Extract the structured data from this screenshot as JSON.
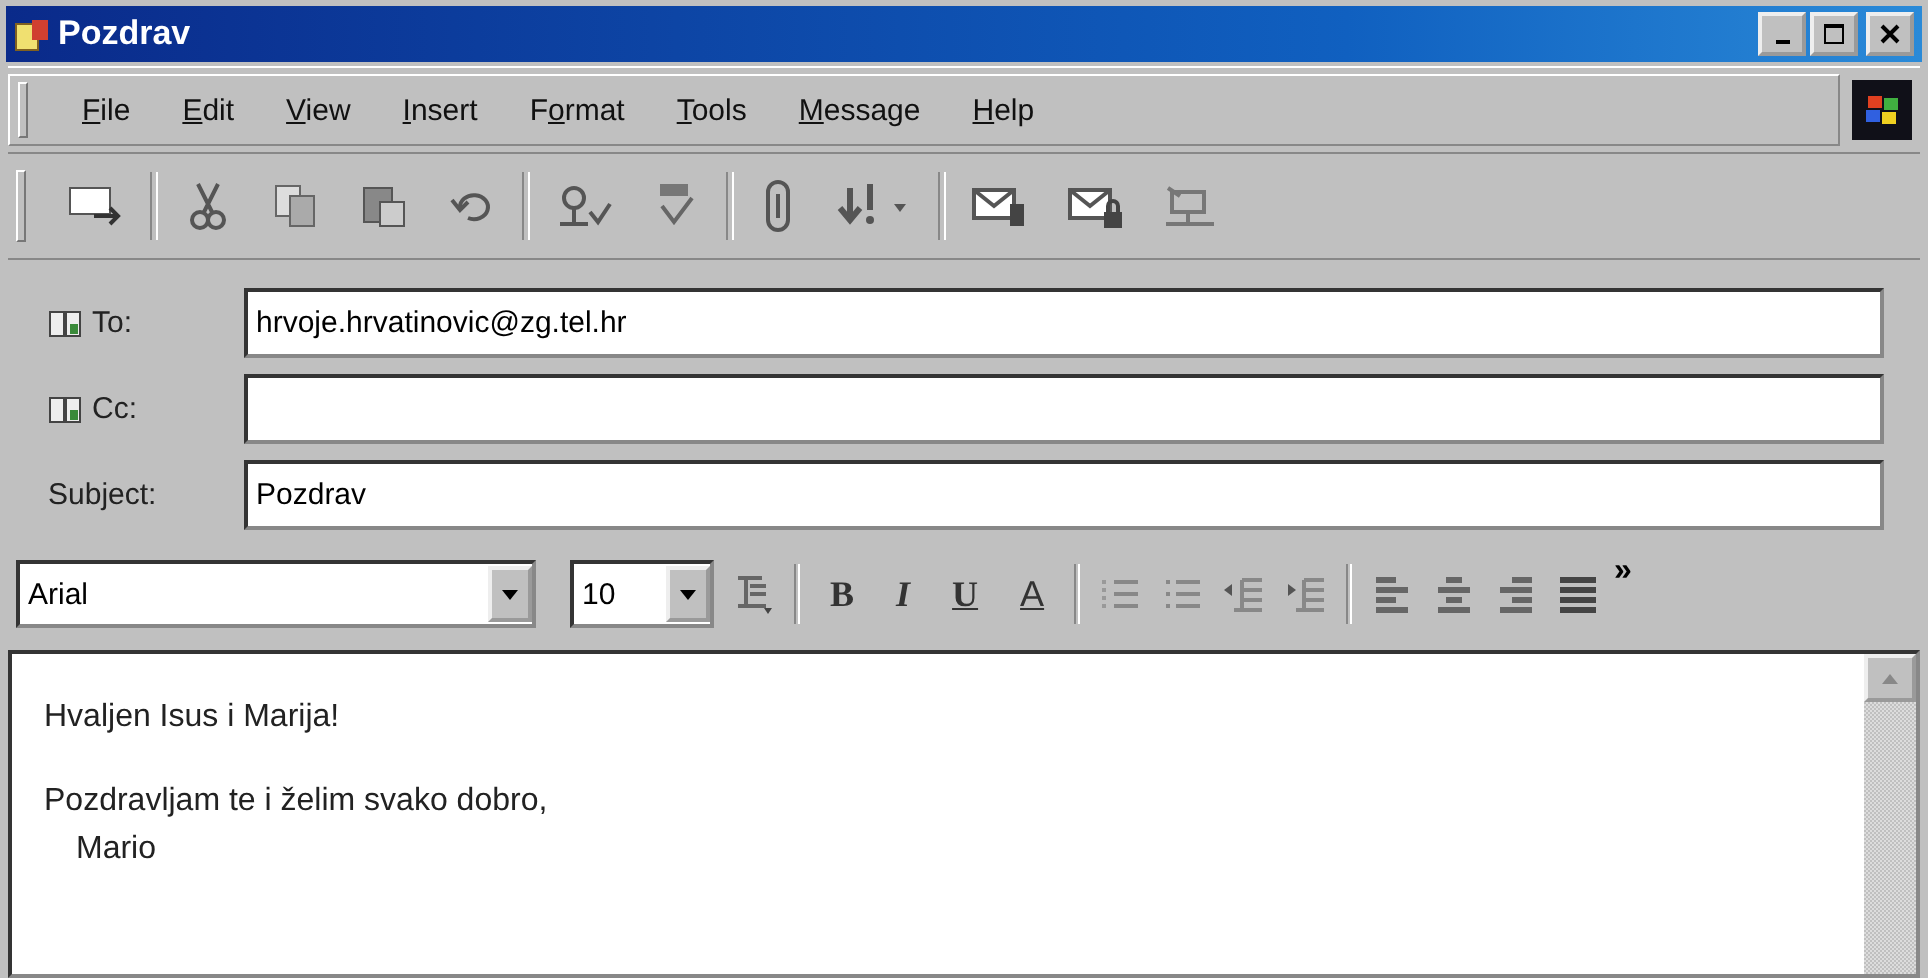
{
  "window": {
    "title": "Pozdrav"
  },
  "menu": [
    {
      "access_key": "F",
      "rest": "ile"
    },
    {
      "access_key": "E",
      "rest": "dit"
    },
    {
      "access_key": "V",
      "rest": "iew"
    },
    {
      "access_key": "I",
      "rest": "nsert"
    },
    {
      "lead": "F",
      "access_key": "o",
      "rest": "rmat"
    },
    {
      "access_key": "T",
      "rest": "ools"
    },
    {
      "access_key": "M",
      "rest": "essage"
    },
    {
      "access_key": "H",
      "rest": "elp"
    }
  ],
  "toolbar": [
    {
      "kind": "send"
    },
    {
      "kind": "sep"
    },
    {
      "kind": "cut"
    },
    {
      "kind": "copy"
    },
    {
      "kind": "paste"
    },
    {
      "kind": "undo"
    },
    {
      "kind": "sep"
    },
    {
      "kind": "check-names"
    },
    {
      "kind": "spelling"
    },
    {
      "kind": "sep"
    },
    {
      "kind": "attach"
    },
    {
      "kind": "priority"
    },
    {
      "kind": "sep"
    },
    {
      "kind": "sign"
    },
    {
      "kind": "encrypt"
    },
    {
      "kind": "offline"
    }
  ],
  "fields": [
    {
      "kind": "address",
      "label": "To:",
      "value": "hrvoje.hrvatinovic@zg.tel.hr"
    },
    {
      "kind": "address",
      "label": "Cc:"
    },
    {
      "kind": "plain",
      "label": "Subject:",
      "value": "Pozdrav"
    }
  ],
  "format_bar": {
    "font": "Arial",
    "size": "10",
    "style_buttons": [
      {
        "label": "B",
        "kind": "bold"
      },
      {
        "label": "I",
        "kind": "italic"
      },
      {
        "label": "U",
        "kind": "underline"
      },
      {
        "label": "A",
        "kind": "color"
      }
    ],
    "more": "»"
  },
  "body": {
    "paragraphs": [
      {
        "lines": [
          {
            "text": "Hvaljen Isus i Marija!",
            "indented": false
          }
        ]
      },
      {
        "lines": [
          {
            "text": "Pozdravljam te i želim svako dobro,",
            "indented": false
          },
          {
            "text": "Mario",
            "indented": true
          }
        ]
      }
    ]
  }
}
